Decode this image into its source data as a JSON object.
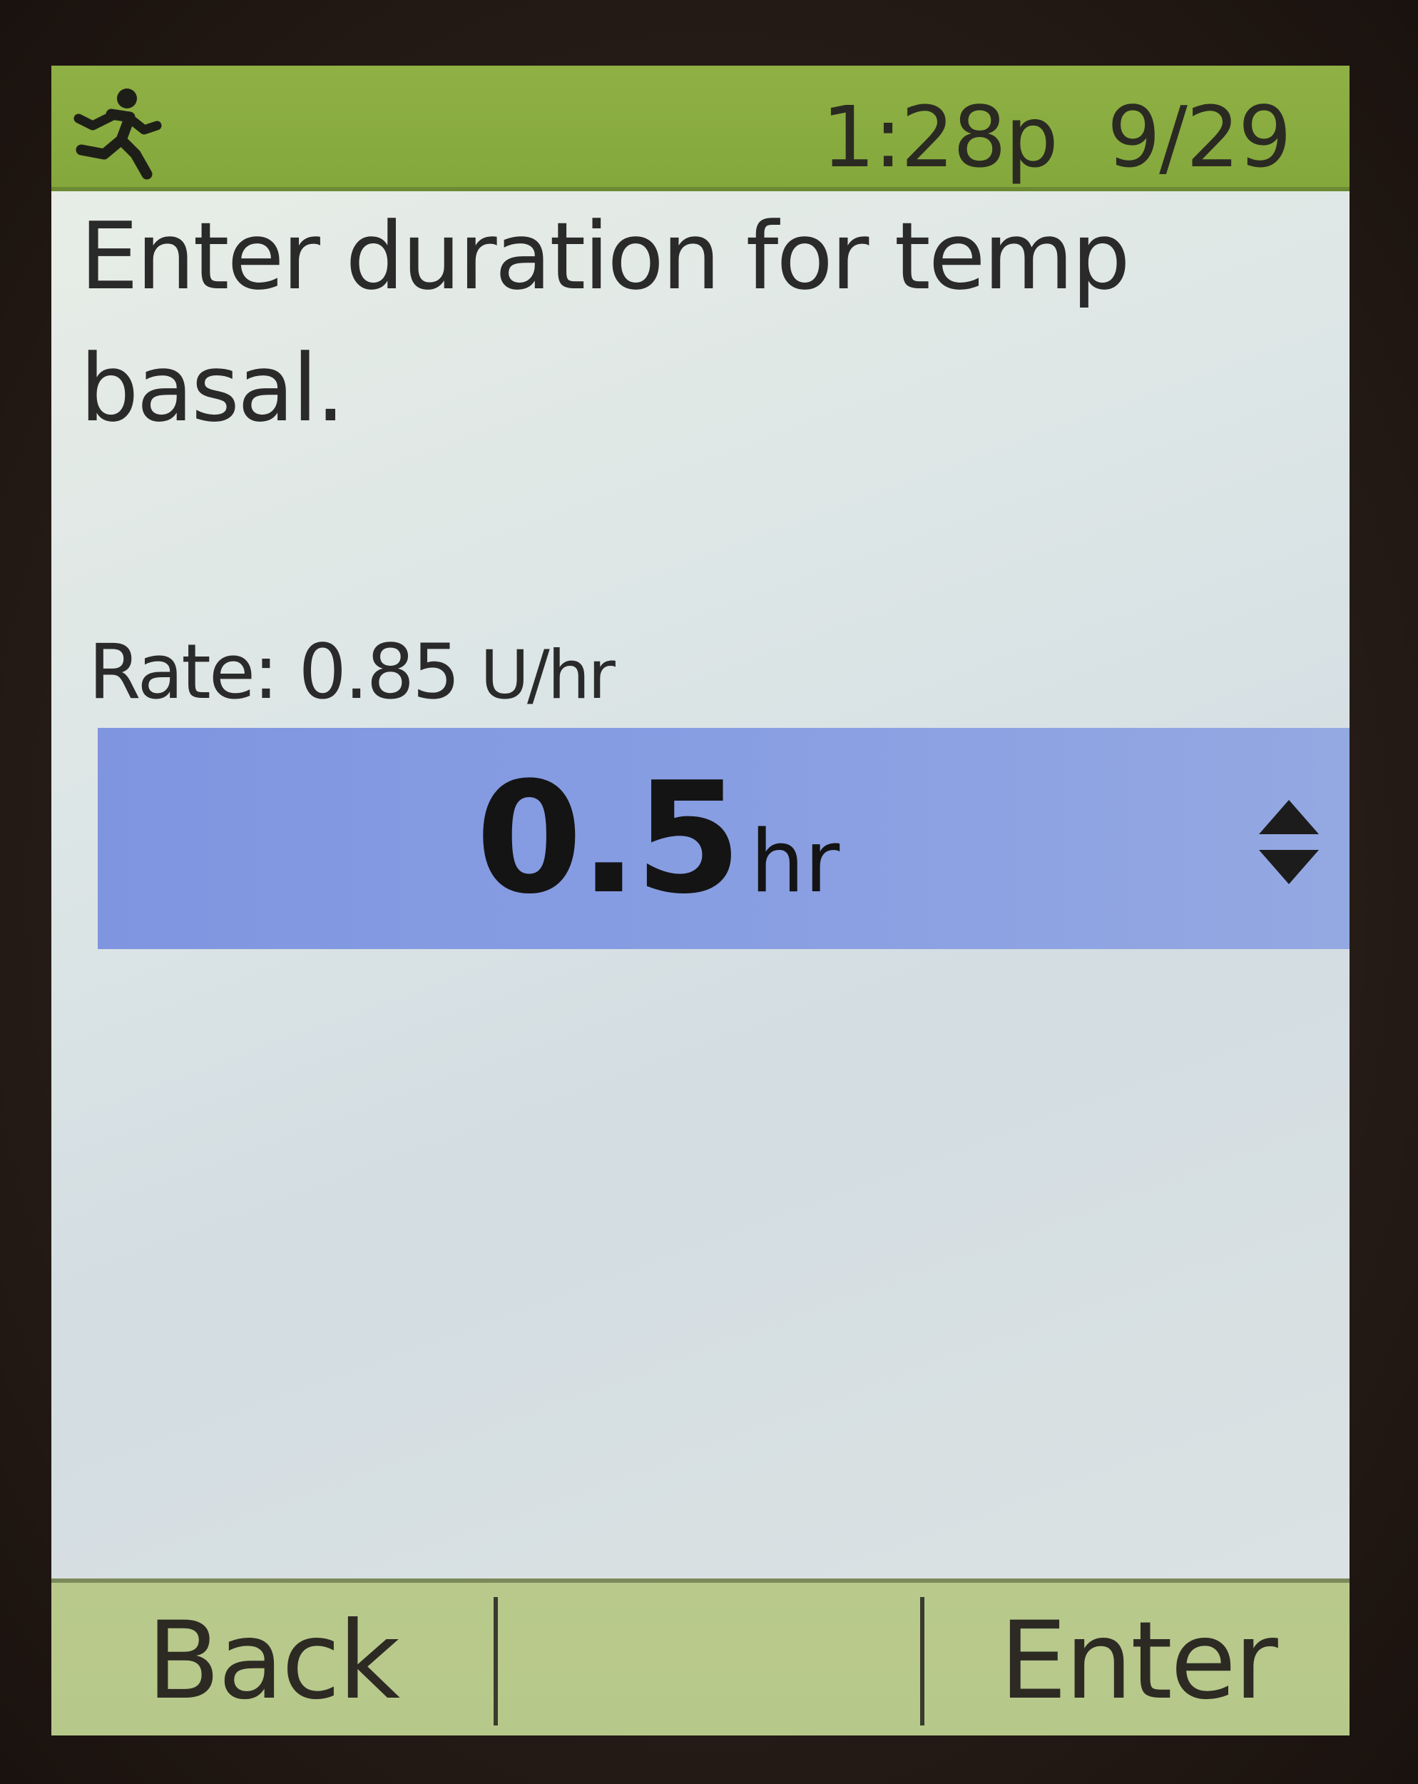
{
  "status_bar": {
    "activity_icon": "running-person-icon",
    "time": "1:28p",
    "date": "9/29"
  },
  "prompt": "Enter duration for temp basal.",
  "rate": {
    "label": "Rate: 0.85",
    "unit": "U/hr"
  },
  "duration": {
    "value": "0.5",
    "unit": "hr",
    "stepper_icon": "up-down-arrows-icon"
  },
  "softkeys": {
    "left": "Back",
    "middle": "",
    "right": "Enter"
  },
  "colors": {
    "status_bar": "#88ab3f",
    "selection": "#889ee2",
    "softkey_bar": "#b8c98b",
    "screen": "#e2e8e6"
  }
}
